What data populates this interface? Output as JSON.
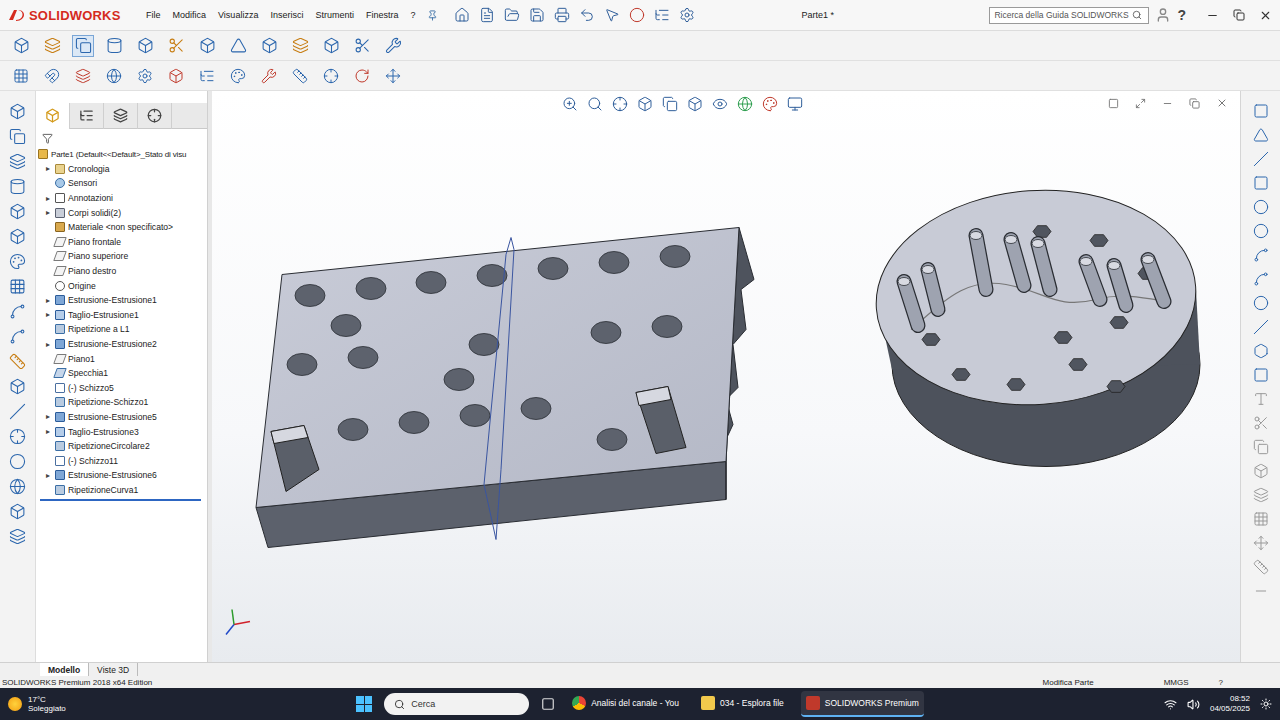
{
  "app": {
    "logo": "SOLIDWORKS",
    "document_title": "Parte1 *",
    "search_placeholder": "Ricerca della Guida SOLIDWORKS",
    "help": "?"
  },
  "menu": [
    "File",
    "Modifica",
    "Visualizza",
    "Inserisci",
    "Strumenti",
    "Finestra",
    "?"
  ],
  "feature_tree": {
    "root": "Parte1  (Default<<Default>_Stato di visu",
    "expander": "▸",
    "items": [
      {
        "label": "Cronologia",
        "kind": "folder",
        "expandable": true
      },
      {
        "label": "Sensori",
        "kind": "sensor",
        "expandable": false
      },
      {
        "label": "Annotazioni",
        "kind": "annotation",
        "expandable": true
      },
      {
        "label": "Corpi solidi(2)",
        "kind": "bodies",
        "expandable": true
      },
      {
        "label": "Materiale <non specificato>",
        "kind": "material",
        "expandable": false
      },
      {
        "label": "Piano frontale",
        "kind": "plane",
        "expandable": false
      },
      {
        "label": "Piano superiore",
        "kind": "plane",
        "expandable": false
      },
      {
        "label": "Piano destro",
        "kind": "plane",
        "expandable": false
      },
      {
        "label": "Origine",
        "kind": "origin",
        "expandable": false
      },
      {
        "label": "Estrusione-Estrusione1",
        "kind": "extrude",
        "expandable": true
      },
      {
        "label": "Taglio-Estrusione1",
        "kind": "cut",
        "expandable": true
      },
      {
        "label": "Ripetizione a L1",
        "kind": "pattern",
        "expandable": false
      },
      {
        "label": "Estrusione-Estrusione2",
        "kind": "extrude",
        "expandable": true
      },
      {
        "label": "Piano1",
        "kind": "plane",
        "expandable": false
      },
      {
        "label": "Specchia1",
        "kind": "mirror",
        "expandable": false
      },
      {
        "label": "(-) Schizzo5",
        "kind": "sketch",
        "expandable": false
      },
      {
        "label": "Ripetizione-Schizzo1",
        "kind": "pattern",
        "expandable": false
      },
      {
        "label": "Estrusione-Estrusione5",
        "kind": "extrude",
        "expandable": true
      },
      {
        "label": "Taglio-Estrusione3",
        "kind": "cut",
        "expandable": true
      },
      {
        "label": "RipetizioneCircolare2",
        "kind": "pattern",
        "expandable": false
      },
      {
        "label": "(-) Schizzo11",
        "kind": "sketch",
        "expandable": false
      },
      {
        "label": "Estrusione-Estrusione6",
        "kind": "extrude",
        "expandable": true
      },
      {
        "label": "RipetizioneCurva1",
        "kind": "pattern",
        "expandable": false
      }
    ]
  },
  "bottom_tabs": [
    {
      "label": "Modello",
      "selected": true
    },
    {
      "label": "Viste 3D",
      "selected": false
    }
  ],
  "status_bar": {
    "left": "SOLIDWORKS Premium 2018 x64 Edition",
    "mode": "Modifica Parte",
    "units": "MMGS",
    "help": "?"
  },
  "taskbar": {
    "weather_temp": "17°C",
    "weather_desc": "Soleggiato",
    "search_placeholder": "Cerca",
    "apps": [
      {
        "label": "Analisi del canale - You",
        "selected": false
      },
      {
        "label": "034 - Esplora file",
        "selected": false
      },
      {
        "label": "SOLIDWORKS Premium",
        "selected": true
      }
    ],
    "time": "08:52",
    "date": "04/05/2025"
  }
}
